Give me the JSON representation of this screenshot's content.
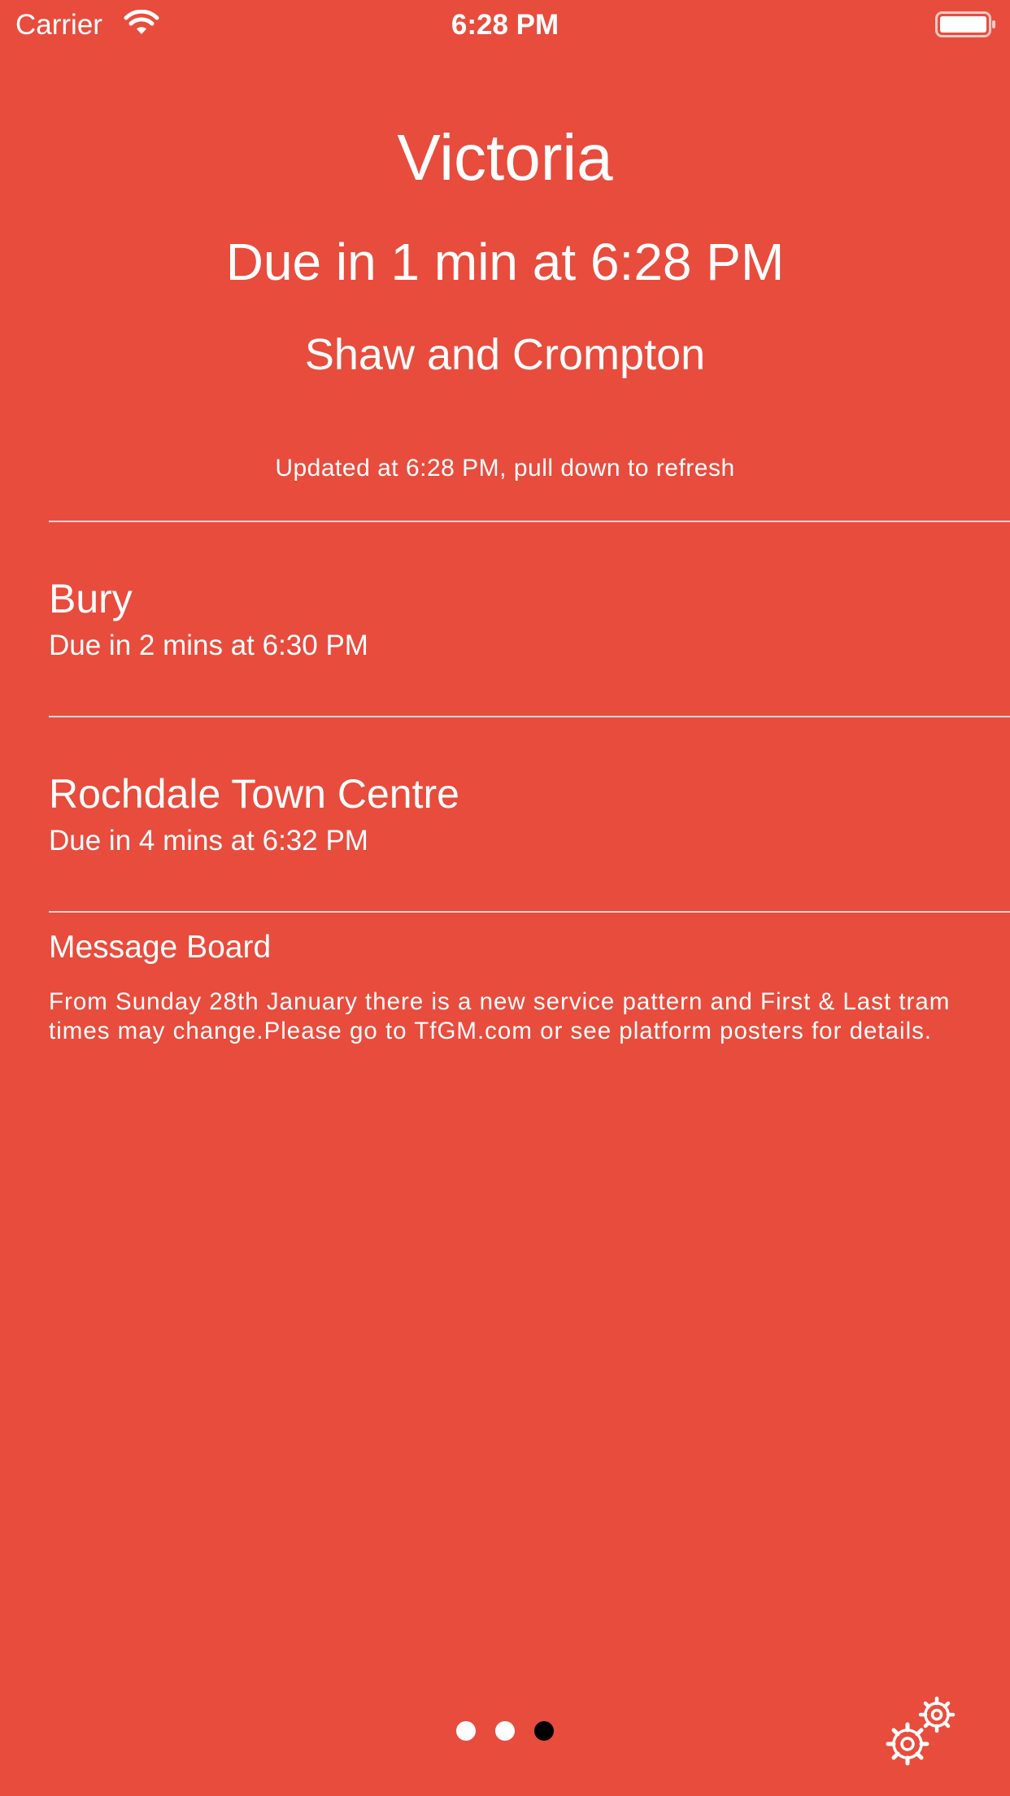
{
  "status_bar": {
    "carrier": "Carrier",
    "time": "6:28 PM",
    "wifi_icon": "wifi-icon",
    "battery_icon": "battery-icon"
  },
  "header": {
    "station": "Victoria",
    "next_due": "Due in 1 min at 6:28 PM",
    "next_destination": "Shaw and Crompton",
    "updated": "Updated at 6:28 PM, pull down to refresh"
  },
  "trams": [
    {
      "destination": "Bury",
      "due": "Due in 2 mins at 6:30 PM"
    },
    {
      "destination": "Rochdale Town Centre",
      "due": "Due in 4 mins at 6:32 PM"
    }
  ],
  "message_board": {
    "title": "Message Board",
    "text": "From Sunday 28th January there is a new service pattern and First & Last tram times may change.Please go to TfGM.com or see platform posters for details."
  },
  "pager": {
    "count": 3,
    "active_index": 2
  },
  "settings_icon": "gears-icon",
  "colors": {
    "background": "#E84C3D",
    "text": "#FFFFFF",
    "active_dot": "#000000"
  }
}
